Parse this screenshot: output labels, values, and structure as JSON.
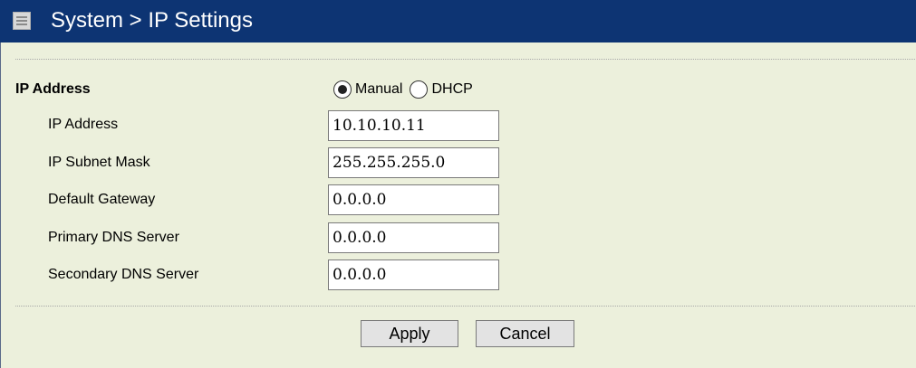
{
  "header": {
    "title": "System > IP Settings",
    "icon": "menu-list-icon"
  },
  "section": {
    "title": "IP Address",
    "mode_options": [
      {
        "label": "Manual",
        "checked": true
      },
      {
        "label": "DHCP",
        "checked": false
      }
    ]
  },
  "fields": [
    {
      "label": "IP Address",
      "value": "10.10.10.11"
    },
    {
      "label": "IP Subnet Mask",
      "value": "255.255.255.0"
    },
    {
      "label": "Default Gateway",
      "value": "0.0.0.0"
    },
    {
      "label": "Primary DNS Server",
      "value": "0.0.0.0"
    },
    {
      "label": "Secondary DNS Server",
      "value": "0.0.0.0"
    }
  ],
  "buttons": {
    "apply": "Apply",
    "cancel": "Cancel"
  },
  "colors": {
    "header_bg": "#0d3473",
    "panel_bg": "#ecf0dc",
    "button_bg": "#e3e3e3"
  }
}
